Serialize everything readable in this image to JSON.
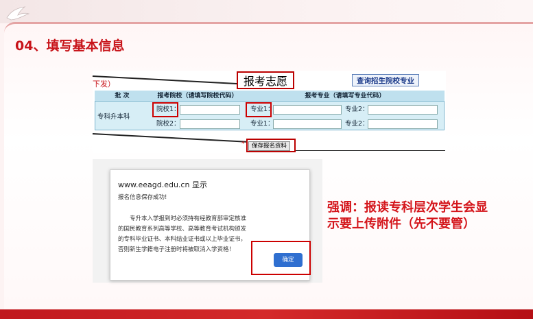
{
  "slide": {
    "title": "04、填写基本信息",
    "emphasis": "强调：报读专科层次学生会显\n示要上传附件（先不要管）"
  },
  "screenshot": {
    "heading_fragment": "下发）",
    "wish_label": "报考志愿",
    "query_button": "查询招生院校专业",
    "table": {
      "headers": [
        "批 次",
        "报考院校（请填写院校代码）",
        "报考专业（请填写专业代码）"
      ],
      "batch": "专科升本科",
      "school_labels": [
        "院校1：",
        "院校2："
      ],
      "major_labels": [
        "专业1：",
        "专业2：",
        "专业1：",
        "专业2："
      ],
      "school_values": [
        "",
        ""
      ],
      "major_values": [
        "",
        "",
        "",
        ""
      ]
    },
    "required_mark": "*",
    "save_button": "保存报名资料"
  },
  "dialog": {
    "origin": "www.eeagd.edu.cn 显示",
    "message": "报名信息保存成功!",
    "body": "专升本入学报到时必须持有经教育部审定核准的国民教育系列高等学校、高等教育考试机构颁发的专科毕业证书、本科结业证书或以上毕业证书，否则新生学籍电子注册时将被取消入学资格！",
    "ok_button": "确定"
  },
  "colors": {
    "accent_red": "#d4151b",
    "table_bg": "#d7eef6",
    "ok_blue": "#2f6fd0"
  },
  "icons": [
    "dove-logo-icon"
  ]
}
